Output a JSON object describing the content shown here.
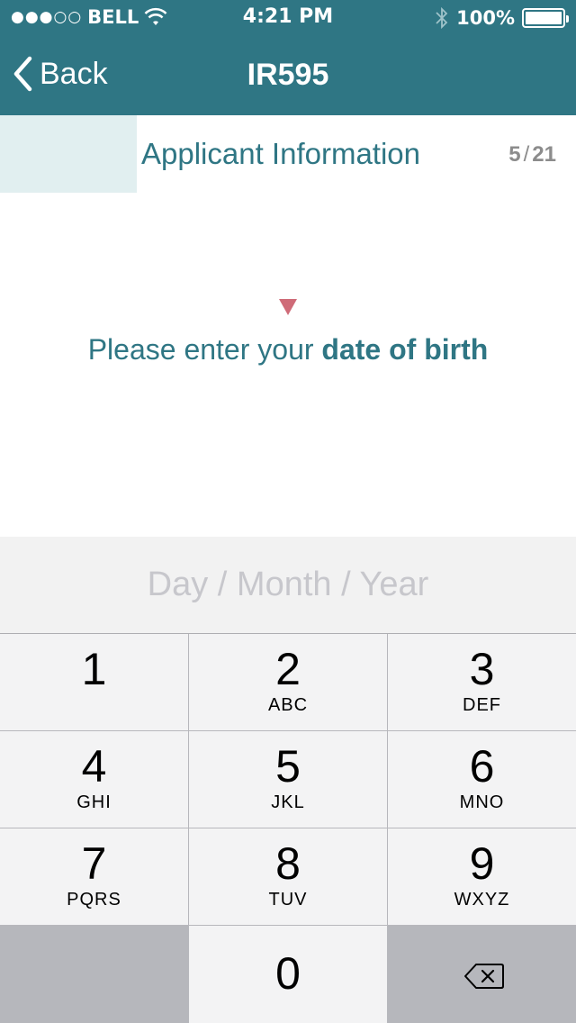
{
  "status_bar": {
    "signal": "●●●○○",
    "carrier": "BELL",
    "time": "4:21 PM",
    "battery": "100%",
    "icons": [
      "wifi-icon",
      "bluetooth-icon",
      "battery-icon"
    ]
  },
  "nav": {
    "back_label": "Back",
    "title": "IR595",
    "back_icon": "chevron-left-icon"
  },
  "progress": {
    "section": "Applicant Information",
    "current": "5",
    "separator": "/",
    "total": "21",
    "fraction": 0.238
  },
  "prompt": {
    "text": "Please enter your ",
    "emphasis": "date of birth"
  },
  "date_input": {
    "value": "",
    "placeholder": "Day / Month / Year"
  },
  "keypad": {
    "keys": [
      {
        "digit": "1",
        "letters": ""
      },
      {
        "digit": "2",
        "letters": "ABC"
      },
      {
        "digit": "3",
        "letters": "DEF"
      },
      {
        "digit": "4",
        "letters": "GHI"
      },
      {
        "digit": "5",
        "letters": "JKL"
      },
      {
        "digit": "6",
        "letters": "MNO"
      },
      {
        "digit": "7",
        "letters": "PQRS"
      },
      {
        "digit": "8",
        "letters": "TUV"
      },
      {
        "digit": "9",
        "letters": "WXYZ"
      },
      {
        "digit": "0",
        "letters": ""
      }
    ],
    "backspace_icon": "backspace-icon"
  },
  "colors": {
    "brand": "#2f7684",
    "accent": "#cf6b78",
    "progress_fill": "#e1eff0"
  }
}
